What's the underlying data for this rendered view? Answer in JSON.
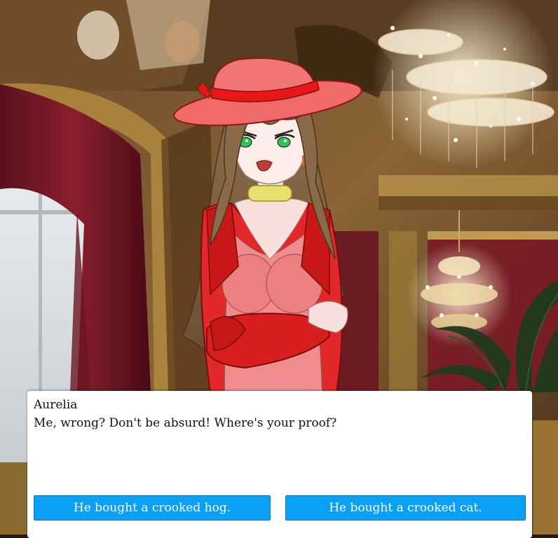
{
  "dialog": {
    "speaker": "Aurelia",
    "line": "Me, wrong? Don't be absurd! Where's your proof?"
  },
  "choices": [
    {
      "label": "He bought a crooked hog."
    },
    {
      "label": "He bought a crooked cat."
    }
  ],
  "colors": {
    "button_bg": "#0aa0f5",
    "dialog_bg": "#ffffff",
    "hat": "#f06a6a",
    "dress": "#e02020"
  }
}
